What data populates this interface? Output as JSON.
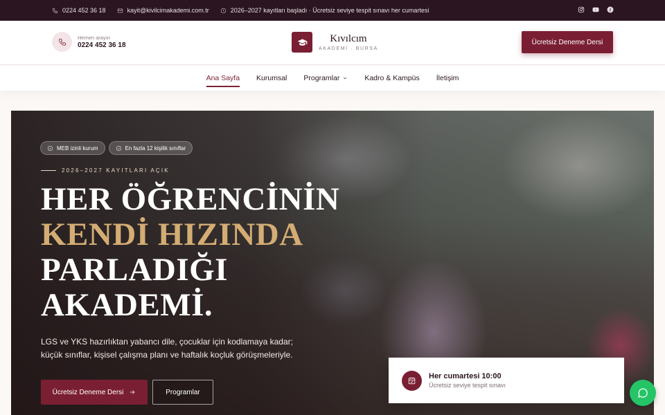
{
  "topbar": {
    "phone": "0224 452 36 18",
    "email": "kayit@kivilcimakademi.com.tr",
    "notice": "2026–2027 kayıtları başladı · Ücretsiz seviye tespit sınavı her cumartesi",
    "social": [
      "instagram-icon",
      "youtube-icon",
      "facebook-icon"
    ]
  },
  "header": {
    "phone_caption": "Hemen arayın",
    "phone_number": "0224 452 36 18",
    "brand_name": "Kıvılcım",
    "brand_sub": "AKADEMİ · BURSA",
    "cta": "Ücretsiz Deneme Dersi"
  },
  "nav": {
    "items": [
      {
        "label": "Ana Sayfa",
        "active": true
      },
      {
        "label": "Kurumsal"
      },
      {
        "label": "Programlar",
        "dropdown": true
      },
      {
        "label": "Kadro & Kampüs"
      },
      {
        "label": "İletişim"
      }
    ]
  },
  "hero": {
    "chips": [
      "MEB izinli kurum",
      "En fazla 12 kişilik sınıflar"
    ],
    "eyebrow": "2026–2027 KAYITLARI AÇIK",
    "headline_line1": "HER ÖĞRENCİNİN",
    "headline_line2": "KENDİ HIZINDA",
    "headline_line3": "PARLADIĞI",
    "headline_line4": "AKADEMİ.",
    "lead": "LGS ve YKS hazırlıktan yabancı dile, çocuklar için kodlamaya kadar; küçük sınıflar, kişisel çalışma planı ve haftalık koçluk görüşmeleriyle.",
    "primary_button": "Ücretsiz Deneme Dersi",
    "secondary_button": "Programlar"
  },
  "info_card": {
    "title": "Her cumartesi 10:00",
    "subtitle": "Ücretsiz seviye tespit sınavı"
  },
  "colors": {
    "brand": "#7a1f33",
    "dark": "#2a1520",
    "gold": "#d4ad74",
    "chat": "#25c466"
  }
}
